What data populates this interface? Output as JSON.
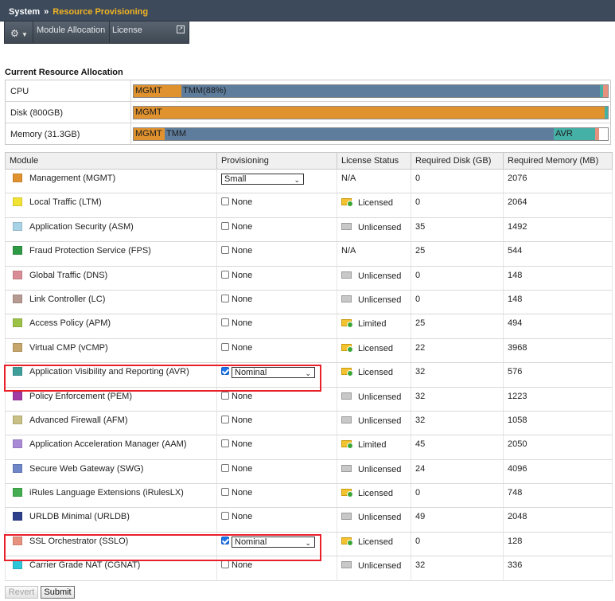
{
  "breadcrumb": {
    "section": "System",
    "separator": "»",
    "page": "Resource Provisioning"
  },
  "tabs": {
    "module_allocation": "Module Allocation",
    "license": "License"
  },
  "allocation": {
    "title": "Current Resource Allocation",
    "rows": [
      {
        "label": "CPU",
        "segments": [
          {
            "text": "MGMT",
            "fraction": 0.1,
            "color": "#e0922f"
          },
          {
            "text": "TMM(88%)",
            "fraction": 0.883,
            "color": "#5e7d9c"
          },
          {
            "text": "",
            "fraction": 0.007,
            "color": "#45b0a6"
          },
          {
            "text": "",
            "fraction": 0.01,
            "color": "#e7917f"
          }
        ]
      },
      {
        "label": "Disk (800GB)",
        "segments": [
          {
            "text": "MGMT",
            "fraction": 0.993,
            "color": "#e0922f"
          },
          {
            "text": "",
            "fraction": 0.007,
            "color": "#45b0a6"
          }
        ]
      },
      {
        "label": "Memory (31.3GB)",
        "segments": [
          {
            "text": "MGMT",
            "fraction": 0.066,
            "color": "#e0922f"
          },
          {
            "text": "TMM",
            "fraction": 0.82,
            "color": "#5e7d9c"
          },
          {
            "text": "AVR",
            "fraction": 0.087,
            "color": "#45b0a6"
          },
          {
            "text": "",
            "fraction": 0.008,
            "color": "#e7917f"
          }
        ]
      }
    ]
  },
  "table": {
    "headers": [
      "Module",
      "Provisioning",
      "License Status",
      "Required Disk (GB)",
      "Required Memory (MB)"
    ],
    "rows": [
      {
        "module": "Management (MGMT)",
        "color": "#e0922f",
        "prov": {
          "kind": "select",
          "value": "Small"
        },
        "license": "N/A",
        "licensed": "none",
        "disk": "0",
        "memory": "2076"
      },
      {
        "module": "Local Traffic (LTM)",
        "color": "#f2e234",
        "prov": {
          "kind": "check",
          "checked": false,
          "label": "None"
        },
        "license": "Licensed",
        "licensed": "licensed",
        "disk": "0",
        "memory": "2064"
      },
      {
        "module": "Application Security (ASM)",
        "color": "#a8d3e6",
        "prov": {
          "kind": "check",
          "checked": false,
          "label": "None"
        },
        "license": "Unlicensed",
        "licensed": "unlicensed",
        "disk": "35",
        "memory": "1492"
      },
      {
        "module": "Fraud Protection Service (FPS)",
        "color": "#2f9a45",
        "prov": {
          "kind": "check",
          "checked": false,
          "label": "None"
        },
        "license": "N/A",
        "licensed": "none",
        "disk": "25",
        "memory": "544"
      },
      {
        "module": "Global Traffic (DNS)",
        "color": "#d98c96",
        "prov": {
          "kind": "check",
          "checked": false,
          "label": "None"
        },
        "license": "Unlicensed",
        "licensed": "unlicensed",
        "disk": "0",
        "memory": "148"
      },
      {
        "module": "Link Controller (LC)",
        "color": "#b79a92",
        "prov": {
          "kind": "check",
          "checked": false,
          "label": "None"
        },
        "license": "Unlicensed",
        "licensed": "unlicensed",
        "disk": "0",
        "memory": "148"
      },
      {
        "module": "Access Policy (APM)",
        "color": "#9dc248",
        "prov": {
          "kind": "check",
          "checked": false,
          "label": "None"
        },
        "license": "Limited",
        "licensed": "licensed",
        "disk": "25",
        "memory": "494"
      },
      {
        "module": "Virtual CMP (vCMP)",
        "color": "#c7a66b",
        "prov": {
          "kind": "check",
          "checked": false,
          "label": "None"
        },
        "license": "Licensed",
        "licensed": "licensed",
        "disk": "22",
        "memory": "3968"
      },
      {
        "module": "Application Visibility and Reporting (AVR)",
        "color": "#3d9e9a",
        "prov": {
          "kind": "checkselect",
          "checked": true,
          "value": "Nominal"
        },
        "license": "Licensed",
        "licensed": "licensed",
        "disk": "32",
        "memory": "576"
      },
      {
        "module": "Policy Enforcement (PEM)",
        "color": "#a23aa6",
        "prov": {
          "kind": "check",
          "checked": false,
          "label": "None"
        },
        "license": "Unlicensed",
        "licensed": "unlicensed",
        "disk": "32",
        "memory": "1223"
      },
      {
        "module": "Advanced Firewall (AFM)",
        "color": "#c8c084",
        "prov": {
          "kind": "check",
          "checked": false,
          "label": "None"
        },
        "license": "Unlicensed",
        "licensed": "unlicensed",
        "disk": "32",
        "memory": "1058"
      },
      {
        "module": "Application Acceleration Manager (AAM)",
        "color": "#a98ad6",
        "prov": {
          "kind": "check",
          "checked": false,
          "label": "None"
        },
        "license": "Limited",
        "licensed": "licensed",
        "disk": "45",
        "memory": "2050"
      },
      {
        "module": "Secure Web Gateway (SWG)",
        "color": "#6f86c9",
        "prov": {
          "kind": "check",
          "checked": false,
          "label": "None"
        },
        "license": "Unlicensed",
        "licensed": "unlicensed",
        "disk": "24",
        "memory": "4096"
      },
      {
        "module": "iRules Language Extensions (iRulesLX)",
        "color": "#43ad4f",
        "prov": {
          "kind": "check",
          "checked": false,
          "label": "None"
        },
        "license": "Licensed",
        "licensed": "licensed",
        "disk": "0",
        "memory": "748"
      },
      {
        "module": "URLDB Minimal (URLDB)",
        "color": "#2e3f8c",
        "prov": {
          "kind": "check",
          "checked": false,
          "label": "None"
        },
        "license": "Unlicensed",
        "licensed": "unlicensed",
        "disk": "49",
        "memory": "2048"
      },
      {
        "module": "SSL Orchestrator (SSLO)",
        "color": "#e7917f",
        "prov": {
          "kind": "checkselect",
          "checked": true,
          "value": "Nominal"
        },
        "license": "Licensed",
        "licensed": "licensed",
        "disk": "0",
        "memory": "128"
      },
      {
        "module": "Carrier Grade NAT (CGNAT)",
        "color": "#2ec7d9",
        "prov": {
          "kind": "check",
          "checked": false,
          "label": "None"
        },
        "license": "Unlicensed",
        "licensed": "unlicensed",
        "disk": "32",
        "memory": "336"
      }
    ]
  },
  "buttons": {
    "revert": "Revert",
    "submit": "Submit"
  },
  "icons": {
    "gear": "gear-icon",
    "dropdown": "chevron-down-icon",
    "popout": "external-link-icon",
    "licensed": "license-ok-icon",
    "unlicensed": "license-none-icon"
  },
  "colors": {
    "header_bg": "#3d4a5b",
    "breadcrumb_accent": "#f2b423",
    "highlight": "#e8202a"
  }
}
